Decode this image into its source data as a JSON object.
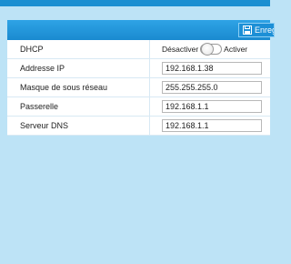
{
  "toolbar": {
    "save_label": "Enregistrer"
  },
  "dhcp": {
    "label": "DHCP",
    "off_label": "Désactiver",
    "on_label": "Activer",
    "enabled": false
  },
  "fields": {
    "ip": {
      "label": "Addresse IP",
      "value": "192.168.1.38"
    },
    "mask": {
      "label": "Masque de sous réseau",
      "value": "255.255.255.0"
    },
    "gateway": {
      "label": "Passerelle",
      "value": "192.168.1.1"
    },
    "dns": {
      "label": "Serveur DNS",
      "value": "192.168.1.1"
    }
  },
  "colors": {
    "header": "#1a8ad0",
    "background": "#bde3f6"
  }
}
